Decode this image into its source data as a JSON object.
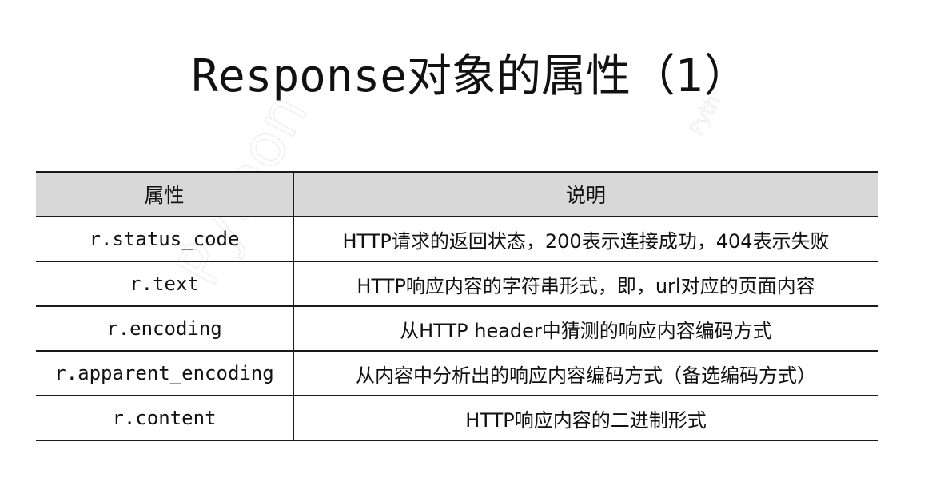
{
  "title": {
    "en": "Response",
    "zh": "对象的属性（1）"
  },
  "table": {
    "headers": [
      "属性",
      "说明"
    ],
    "rows": [
      {
        "attr": "r.status_code",
        "desc": "HTTP请求的返回状态，200表示连接成功，404表示失败"
      },
      {
        "attr": "r.text",
        "desc": "HTTP响应内容的字符串形式，即，url对应的页面内容"
      },
      {
        "attr": "r.encoding",
        "desc": "从HTTP header中猜测的响应内容编码方式"
      },
      {
        "attr": "r.apparent_encoding",
        "desc": "从内容中分析出的响应内容编码方式（备选编码方式）"
      },
      {
        "attr": "r.content",
        "desc": "HTTP响应内容的二进制形式"
      }
    ]
  },
  "colors": {
    "header_bg": "#d8d8d8",
    "rule": "#1a1a1a",
    "text": "#111111"
  }
}
